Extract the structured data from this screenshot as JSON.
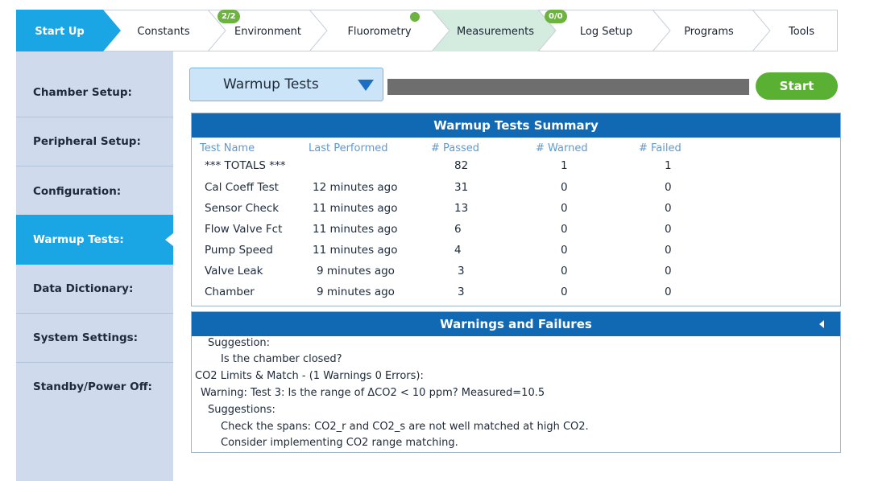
{
  "tabs": [
    {
      "label": "Start Up",
      "active": true
    },
    {
      "label": "Constants",
      "active": false
    },
    {
      "label": "Environment",
      "active": false,
      "badge": "2/2"
    },
    {
      "label": "Fluorometry",
      "active": false,
      "status_dot": "connected"
    },
    {
      "label": "Measurements",
      "active": false,
      "highlight": true
    },
    {
      "label": "Log Setup",
      "active": false,
      "badge": "0/0"
    },
    {
      "label": "Programs",
      "active": false
    },
    {
      "label": "Tools",
      "active": false
    }
  ],
  "sidebar": {
    "items": [
      {
        "label": "Chamber Setup:",
        "active": false
      },
      {
        "label": "Peripheral Setup:",
        "active": false
      },
      {
        "label": "Configuration:",
        "active": false
      },
      {
        "label": "Warmup Tests:",
        "active": true
      },
      {
        "label": "Data Dictionary:",
        "active": false
      },
      {
        "label": "System Settings:",
        "active": false
      },
      {
        "label": "Standby/Power Off:",
        "active": false
      }
    ]
  },
  "toolbar": {
    "dropdown_value": "Warmup Tests",
    "progress_fraction": 0,
    "start_label": "Start"
  },
  "summary": {
    "title": "Warmup Tests Summary",
    "columns": [
      "Test Name",
      "Last Performed",
      "# Passed",
      "# Warned",
      "# Failed"
    ],
    "rows": [
      {
        "name": "*** TOTALS ***",
        "last": "",
        "passed": "82",
        "warned": "1",
        "failed": "1"
      },
      {
        "name": "Cal Coeff Test",
        "last": "12 minutes ago",
        "passed": "31",
        "warned": "0",
        "failed": "0"
      },
      {
        "name": "Sensor Check",
        "last": "11 minutes ago",
        "passed": "13",
        "warned": "0",
        "failed": "0"
      },
      {
        "name": "Flow Valve Fct",
        "last": "11 minutes ago",
        "passed": "6",
        "warned": "0",
        "failed": "0"
      },
      {
        "name": "Pump Speed",
        "last": "11 minutes ago",
        "passed": "4",
        "warned": "0",
        "failed": "0"
      },
      {
        "name": "Valve Leak",
        "last": "9 minutes ago",
        "passed": "3",
        "warned": "0",
        "failed": "0"
      },
      {
        "name": "Chamber",
        "last": "9 minutes ago",
        "passed": "3",
        "warned": "0",
        "failed": "0"
      }
    ]
  },
  "warnings": {
    "title": "Warnings and Failures",
    "lines": [
      "Suggestion:",
      "Is the chamber closed?",
      "CO2 Limits & Match - (1 Warnings 0 Errors):",
      "Warning:  Test 3: Is the range of ΔCO2 < 10 ppm? Measured=10.5",
      "Suggestions:",
      "Check the spans: CO2_r and CO2_s are not well matched at high CO2.",
      "Consider implementing CO2 range matching."
    ]
  },
  "colors": {
    "active_tab": "#1aa6e4",
    "highlight_tab": "#d4ece0",
    "panel_header": "#1269b3",
    "accent_green": "#5ab032",
    "sidebar_bg": "#cfdbed"
  }
}
